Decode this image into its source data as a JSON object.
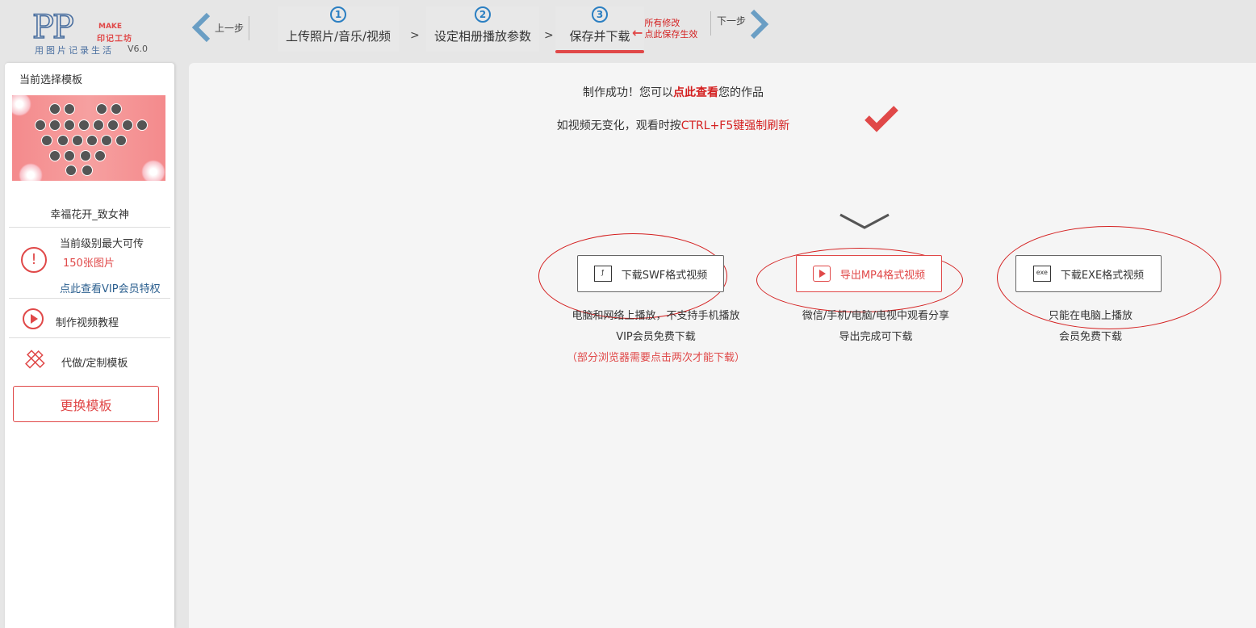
{
  "header": {
    "logo_letters": "PP",
    "logo_make": "MAKE",
    "logo_brand": "印记工坊",
    "logo_slogan": "用图片记录生活",
    "version": "V6.0",
    "prev_label": "上一步",
    "next_label": "下一步",
    "steps": [
      {
        "num": "1",
        "label": "上传照片/音乐/视频"
      },
      {
        "num": "2",
        "label": "设定相册播放参数"
      },
      {
        "num": "3",
        "label": "保存并下载"
      }
    ],
    "step_separator": ">",
    "save_note_line1": "所有修改",
    "save_note_line2": "点此保存生效"
  },
  "sidebar": {
    "title": "当前选择模板",
    "template_name": "幸福花开_致女神",
    "limit_line1": "当前级别最大可传",
    "limit_line2": "150张图片",
    "vip_link": "点此查看VIP会员特权",
    "tutorial": "制作视频教程",
    "custom": "代做/定制模板",
    "change_button": "更换模板"
  },
  "main": {
    "success_pre": "制作成功！您可以",
    "success_link": "点此查看",
    "success_post": "您的作品",
    "hint_pre": "如视频无变化，观看时按",
    "hint_red": "CTRL+F5键强制刷新",
    "downloads": [
      {
        "label": "下载SWF格式视频",
        "icon": "flash-icon",
        "desc1": "电脑和网络上播放，不支持手机播放",
        "desc2": "VIP会员免费下载",
        "desc3": "（部分浏览器需要点击两次才能下载）"
      },
      {
        "label": "导出MP4格式视频",
        "icon": "play-icon",
        "desc1": "微信/手机/电脑/电视中观看分享",
        "desc2": "导出完成可下载"
      },
      {
        "label": "下载EXE格式视频",
        "icon": "exe-icon",
        "icon_text": "exe",
        "desc1": "只能在电脑上播放",
        "desc2": "会员免费下载"
      }
    ]
  },
  "colors": {
    "accent_red": "#e04848",
    "link_red": "#d42020",
    "step_blue": "#2b7fc2"
  }
}
